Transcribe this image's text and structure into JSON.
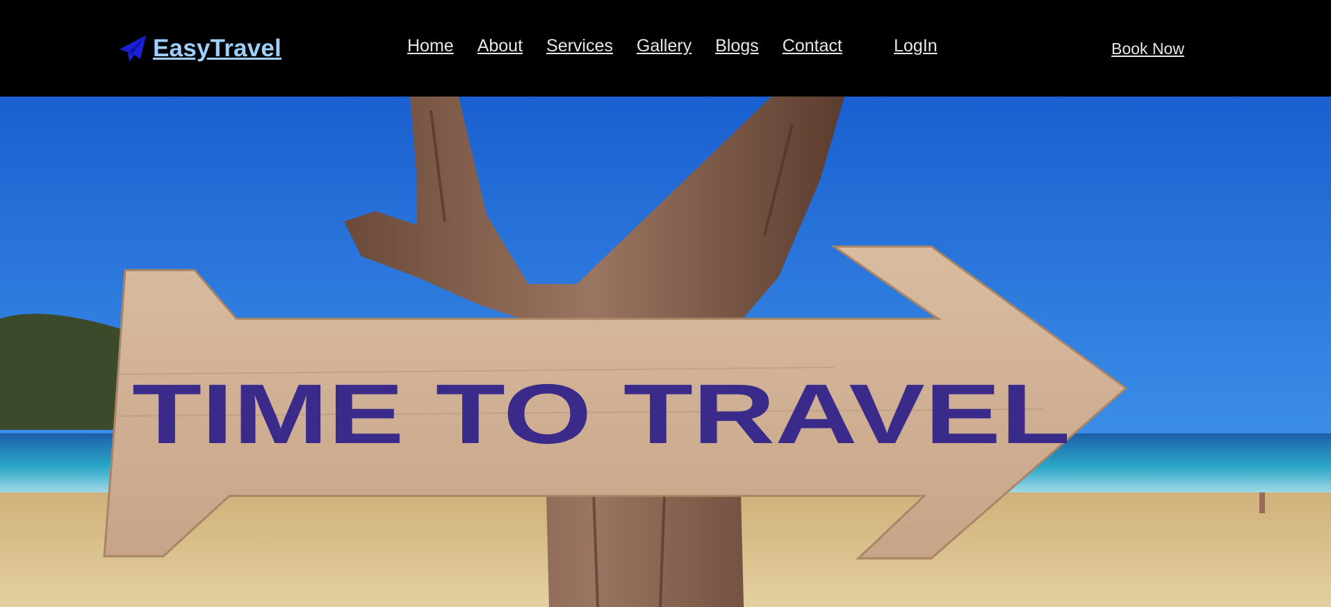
{
  "brand": {
    "name": "EasyTravel",
    "icon": "paper-plane-icon",
    "color": "#9ed0ff",
    "icon_color": "#1a22d8"
  },
  "nav": {
    "items": [
      {
        "label": "Home"
      },
      {
        "label": "About"
      },
      {
        "label": "Services"
      },
      {
        "label": "Gallery"
      },
      {
        "label": "Blogs"
      },
      {
        "label": "Contact"
      }
    ],
    "login_label": "LogIn",
    "book_now_label": "Book Now"
  },
  "hero": {
    "sign_text": "TIME TO TRAVEL",
    "sign_text_color": "#3a2a8a",
    "sky_color": "#1f6fd6",
    "sand_color": "#d9c08c",
    "sea_color": "#2aa6c7"
  }
}
